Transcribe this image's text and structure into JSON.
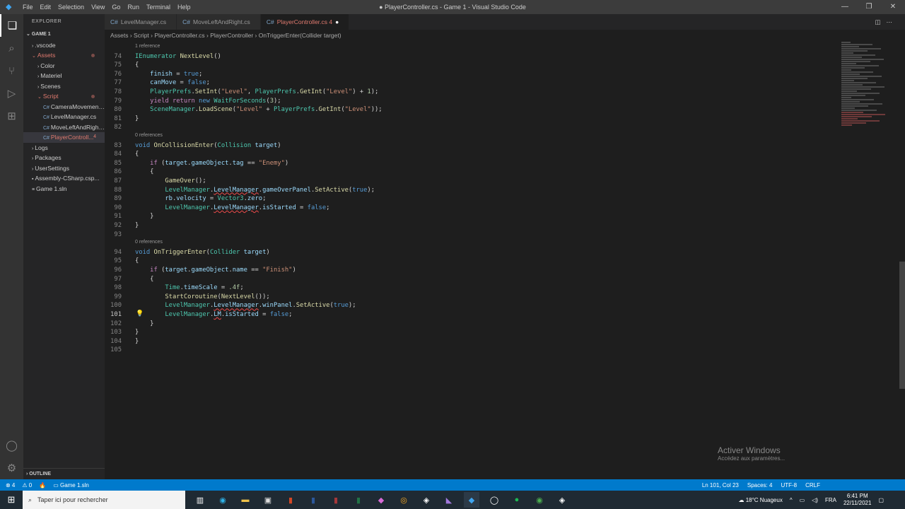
{
  "titlebar": {
    "menu": [
      "File",
      "Edit",
      "Selection",
      "View",
      "Go",
      "Run",
      "Terminal",
      "Help"
    ],
    "title": "● PlayerController.cs - Game 1 - Visual Studio Code"
  },
  "sidebar": {
    "header": "EXPLORER",
    "root": "GAME 1",
    "items": [
      {
        "label": ".vscode",
        "indent": 1,
        "arrow": "›",
        "cls": ""
      },
      {
        "label": "Assets",
        "indent": 1,
        "arrow": "⌄",
        "cls": "mod",
        "dot": true
      },
      {
        "label": "Color",
        "indent": 2,
        "arrow": "›",
        "cls": ""
      },
      {
        "label": "Materiel",
        "indent": 2,
        "arrow": "›",
        "cls": ""
      },
      {
        "label": "Scenes",
        "indent": 2,
        "arrow": "›",
        "cls": ""
      },
      {
        "label": "Script",
        "indent": 2,
        "arrow": "⌄",
        "cls": "mod",
        "dot": true
      },
      {
        "label": "CameraMovement...",
        "indent": 3,
        "arrow": "C#",
        "cls": ""
      },
      {
        "label": "LevelManager.cs",
        "indent": 3,
        "arrow": "C#",
        "cls": ""
      },
      {
        "label": "MoveLeftAndRight...",
        "indent": 3,
        "arrow": "C#",
        "cls": ""
      },
      {
        "label": "PlayerControll...",
        "indent": 3,
        "arrow": "C#",
        "cls": "mod sel",
        "badge": "4"
      },
      {
        "label": "Logs",
        "indent": 1,
        "arrow": "›",
        "cls": ""
      },
      {
        "label": "Packages",
        "indent": 1,
        "arrow": "›",
        "cls": ""
      },
      {
        "label": "UserSettings",
        "indent": 1,
        "arrow": "›",
        "cls": ""
      },
      {
        "label": "Assembly-CSharp.csp...",
        "indent": 1,
        "arrow": "▪",
        "cls": ""
      },
      {
        "label": "Game 1.sln",
        "indent": 1,
        "arrow": "≡",
        "cls": ""
      }
    ],
    "outline": "OUTLINE"
  },
  "tabs": [
    {
      "label": "LevelManager.cs",
      "active": false
    },
    {
      "label": "MoveLeftAndRight.cs",
      "active": false
    },
    {
      "label": "PlayerController.cs 4",
      "active": true,
      "dirty": "●"
    }
  ],
  "breadcrumb": "Assets › Script › PlayerController.cs › PlayerController › OnTriggerEnter(Collider target)",
  "editor": {
    "current_line": 101,
    "rows": [
      {
        "refs": "1 reference"
      },
      {
        "n": 74,
        "t": [
          [
            "IEnumerator ",
            "ty"
          ],
          [
            "NextLevel",
            "fn"
          ],
          [
            "()",
            "pl"
          ]
        ]
      },
      {
        "n": 75,
        "t": [
          [
            "{",
            "pl"
          ]
        ]
      },
      {
        "n": 76,
        "t": [
          [
            "    finish",
            "var"
          ],
          [
            " = ",
            "pl"
          ],
          [
            "true",
            "kw"
          ],
          [
            ";",
            "pl"
          ]
        ]
      },
      {
        "n": 77,
        "t": [
          [
            "    canMove",
            "var"
          ],
          [
            " = ",
            "pl"
          ],
          [
            "false",
            "kw"
          ],
          [
            ";",
            "pl"
          ]
        ]
      },
      {
        "n": 78,
        "t": [
          [
            "    PlayerPrefs",
            "ty"
          ],
          [
            ".",
            "pl"
          ],
          [
            "SetInt",
            "fn"
          ],
          [
            "(",
            "pl"
          ],
          [
            "\"Level\"",
            "str"
          ],
          [
            ", ",
            "pl"
          ],
          [
            "PlayerPrefs",
            "ty"
          ],
          [
            ".",
            "pl"
          ],
          [
            "GetInt",
            "fn"
          ],
          [
            "(",
            "pl"
          ],
          [
            "\"Level\"",
            "str"
          ],
          [
            ") + ",
            "pl"
          ],
          [
            "1",
            "num"
          ],
          [
            ");",
            "pl"
          ]
        ]
      },
      {
        "n": 79,
        "t": [
          [
            "    yield return ",
            "ctl"
          ],
          [
            "new ",
            "kw"
          ],
          [
            "WaitForSeconds",
            "ty"
          ],
          [
            "(",
            "pl"
          ],
          [
            "3",
            "num"
          ],
          [
            ");",
            "pl"
          ]
        ]
      },
      {
        "n": 80,
        "t": [
          [
            "    SceneManager",
            "ty"
          ],
          [
            ".",
            "pl"
          ],
          [
            "LoadScene",
            "fn"
          ],
          [
            "(",
            "pl"
          ],
          [
            "\"Level\"",
            "str"
          ],
          [
            " + ",
            "pl"
          ],
          [
            "PlayerPrefs",
            "ty"
          ],
          [
            ".",
            "pl"
          ],
          [
            "GetInt",
            "fn"
          ],
          [
            "(",
            "pl"
          ],
          [
            "\"Level\"",
            "str"
          ],
          [
            "));",
            "pl"
          ]
        ]
      },
      {
        "n": 81,
        "t": [
          [
            "}",
            "pl"
          ]
        ]
      },
      {
        "n": 82,
        "t": []
      },
      {
        "refs": "0 references"
      },
      {
        "n": 83,
        "t": [
          [
            "void ",
            "kw"
          ],
          [
            "OnCollisionEnter",
            "fn"
          ],
          [
            "(",
            "pl"
          ],
          [
            "Collision ",
            "ty"
          ],
          [
            "target",
            "var"
          ],
          [
            ")",
            "pl"
          ]
        ]
      },
      {
        "n": 84,
        "t": [
          [
            "{",
            "pl"
          ]
        ]
      },
      {
        "n": 85,
        "t": [
          [
            "    if ",
            "ctl"
          ],
          [
            "(",
            "pl"
          ],
          [
            "target",
            "var"
          ],
          [
            ".",
            "pl"
          ],
          [
            "gameObject",
            "var"
          ],
          [
            ".",
            "pl"
          ],
          [
            "tag",
            "var"
          ],
          [
            " == ",
            "pl"
          ],
          [
            "\"Enemy\"",
            "str"
          ],
          [
            ")",
            "pl"
          ]
        ]
      },
      {
        "n": 86,
        "t": [
          [
            "    {",
            "pl"
          ]
        ]
      },
      {
        "n": 87,
        "t": [
          [
            "        GameOver",
            "fn"
          ],
          [
            "();",
            "pl"
          ]
        ]
      },
      {
        "n": 88,
        "t": [
          [
            "        LevelManager",
            "ty"
          ],
          [
            ".",
            "pl"
          ],
          [
            "LevelManager",
            "var err"
          ],
          [
            ".",
            "pl"
          ],
          [
            "gameOverPanel",
            "var"
          ],
          [
            ".",
            "pl"
          ],
          [
            "SetActive",
            "fn"
          ],
          [
            "(",
            "pl"
          ],
          [
            "true",
            "kw"
          ],
          [
            ");",
            "pl"
          ]
        ]
      },
      {
        "n": 89,
        "t": [
          [
            "        rb",
            "var"
          ],
          [
            ".",
            "pl"
          ],
          [
            "velocity",
            "var"
          ],
          [
            " = ",
            "pl"
          ],
          [
            "Vector3",
            "ty"
          ],
          [
            ".",
            "pl"
          ],
          [
            "zero",
            "var"
          ],
          [
            ";",
            "pl"
          ]
        ]
      },
      {
        "n": 90,
        "t": [
          [
            "        LevelManager",
            "ty"
          ],
          [
            ".",
            "pl"
          ],
          [
            "LevelManager",
            "var err"
          ],
          [
            ".",
            "pl"
          ],
          [
            "isStarted",
            "var"
          ],
          [
            " = ",
            "pl"
          ],
          [
            "false",
            "kw"
          ],
          [
            ";",
            "pl"
          ]
        ]
      },
      {
        "n": 91,
        "t": [
          [
            "    }",
            "pl"
          ]
        ]
      },
      {
        "n": 92,
        "t": [
          [
            "}",
            "pl"
          ]
        ]
      },
      {
        "n": 93,
        "t": []
      },
      {
        "refs": "0 references"
      },
      {
        "n": 94,
        "t": [
          [
            "void ",
            "kw"
          ],
          [
            "OnTriggerEnter",
            "fn"
          ],
          [
            "(",
            "pl"
          ],
          [
            "Collider ",
            "ty"
          ],
          [
            "target",
            "var"
          ],
          [
            ")",
            "pl"
          ]
        ]
      },
      {
        "n": 95,
        "t": [
          [
            "{",
            "pl"
          ]
        ]
      },
      {
        "n": 96,
        "t": [
          [
            "    if ",
            "ctl"
          ],
          [
            "(",
            "pl"
          ],
          [
            "target",
            "var"
          ],
          [
            ".",
            "pl"
          ],
          [
            "gameObject",
            "var"
          ],
          [
            ".",
            "pl"
          ],
          [
            "name",
            "var"
          ],
          [
            " == ",
            "pl"
          ],
          [
            "\"Finish\"",
            "str"
          ],
          [
            ")",
            "pl"
          ]
        ]
      },
      {
        "n": 97,
        "t": [
          [
            "    {",
            "pl"
          ]
        ]
      },
      {
        "n": 98,
        "t": [
          [
            "        Time",
            "ty"
          ],
          [
            ".",
            "pl"
          ],
          [
            "timeScale",
            "var"
          ],
          [
            " = ",
            "pl"
          ],
          [
            ".4f",
            "num"
          ],
          [
            ";",
            "pl"
          ]
        ]
      },
      {
        "n": 99,
        "t": [
          [
            "        StartCoroutine",
            "fn"
          ],
          [
            "(",
            "pl"
          ],
          [
            "NextLevel",
            "fn"
          ],
          [
            "());",
            "pl"
          ]
        ]
      },
      {
        "n": 100,
        "t": [
          [
            "        LevelManager",
            "ty"
          ],
          [
            ".",
            "pl"
          ],
          [
            "LevelManager",
            "var err"
          ],
          [
            ".",
            "pl"
          ],
          [
            "winPanel",
            "var"
          ],
          [
            ".",
            "pl"
          ],
          [
            "SetActive",
            "fn"
          ],
          [
            "(",
            "pl"
          ],
          [
            "true",
            "kw"
          ],
          [
            ");",
            "pl"
          ]
        ]
      },
      {
        "n": 101,
        "t": [
          [
            "        LevelManager",
            "ty"
          ],
          [
            ".",
            "pl"
          ],
          [
            "LM",
            "var err"
          ],
          [
            ".",
            "pl"
          ],
          [
            "isStarted",
            "var"
          ],
          [
            " = ",
            "pl"
          ],
          [
            "false",
            "kw"
          ],
          [
            ";",
            "pl"
          ]
        ]
      },
      {
        "n": 102,
        "t": [
          [
            "    }",
            "pl"
          ]
        ]
      },
      {
        "n": 103,
        "t": [
          [
            "}",
            "pl"
          ]
        ]
      },
      {
        "n": 104,
        "t": [
          [
            "}",
            "pl"
          ]
        ]
      },
      {
        "n": 105,
        "t": []
      }
    ]
  },
  "watermark": {
    "title": "Activer Windows",
    "sub": "Accédez aux paramètres..."
  },
  "statusbar": {
    "errors": "⊗ 4",
    "warnings": "⚠ 0",
    "solution": "Game 1.sln",
    "position": "Ln 101, Col 23",
    "spaces": "Spaces: 4",
    "encoding": "UTF-8",
    "eol": "CRLF"
  },
  "taskbar": {
    "search_placeholder": "Taper ici pour rechercher",
    "weather": "18°C  Nuageux",
    "lang": "FRA",
    "time": "6:41 PM",
    "date": "22/11/2021"
  }
}
